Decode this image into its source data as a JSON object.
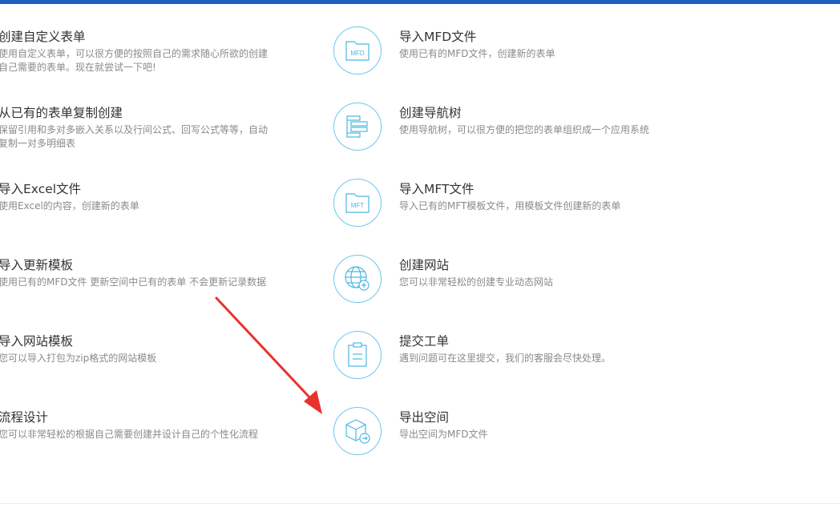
{
  "accent_color": "#1f5fbf",
  "icon_color": "#4bb8e6",
  "left_items": [
    {
      "title": "创建自定义表单",
      "desc": "使用自定义表单，可以很方便的按照自己的需求随心所欲的创建自己需要的表单。现在就尝试一下吧!"
    },
    {
      "title": "从已有的表单复制创建",
      "desc": "保留引用和多对多嵌入关系以及行间公式、回写公式等等，自动复制一对多明细表"
    },
    {
      "title": "导入Excel文件",
      "desc": "使用Excel的内容，创建新的表单"
    },
    {
      "title": "导入更新模板",
      "desc": "使用已有的MFD文件 更新空间中已有的表单 不会更新记录数据"
    },
    {
      "title": "导入网站模板",
      "desc": "您可以导入打包为zip格式的网站模板"
    },
    {
      "title": "流程设计",
      "desc": "您可以非常轻松的根据自己需要创建并设计自己的个性化流程"
    }
  ],
  "right_items": [
    {
      "title": "导入MFD文件",
      "desc": "使用已有的MFD文件，创建新的表单",
      "icon": "mfd-file-icon",
      "icon_label": "MFD"
    },
    {
      "title": "创建导航树",
      "desc": "使用导航树，可以很方便的把您的表单组织成一个应用系统",
      "icon": "navigation-tree-icon"
    },
    {
      "title": "导入MFT文件",
      "desc": "导入已有的MFT模板文件，用模板文件创建新的表单",
      "icon": "mft-file-icon",
      "icon_label": "MFT"
    },
    {
      "title": "创建网站",
      "desc": "您可以非常轻松的创建专业动态网站",
      "icon": "globe-add-icon"
    },
    {
      "title": "提交工单",
      "desc": "遇到问题可在这里提交，我们的客服会尽快处理。",
      "icon": "clipboard-icon"
    },
    {
      "title": "导出空间",
      "desc": "导出空间为MFD文件",
      "icon": "box-export-icon"
    }
  ]
}
